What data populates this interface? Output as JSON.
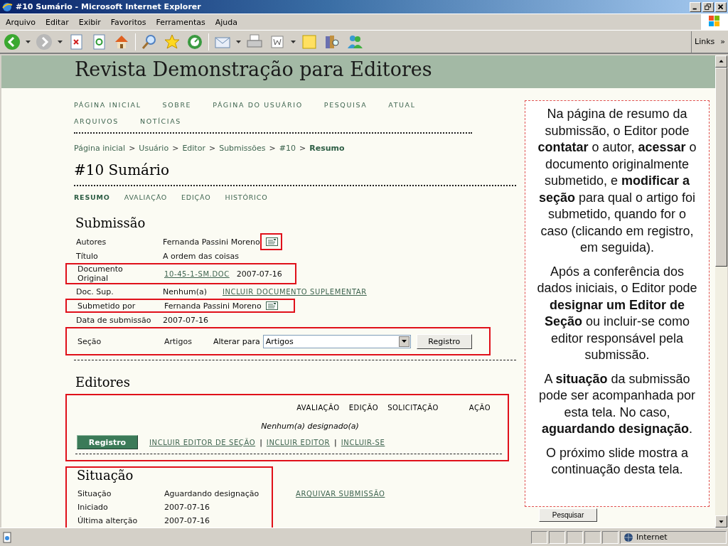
{
  "window": {
    "title": "#10 Sumário - Microsoft Internet Explorer"
  },
  "menu": [
    "Arquivo",
    "Editar",
    "Exibir",
    "Favoritos",
    "Ferramentas",
    "Ajuda"
  ],
  "toolbar": {
    "links": "Links",
    "more": "»"
  },
  "page": {
    "site_title": "Revista Demonstração para Editores",
    "nav": [
      "PÁGINA INICIAL",
      "SOBRE",
      "PÁGINA DO USUÁRIO",
      "PESQUISA",
      "ATUAL",
      "ARQUIVOS",
      "NOTÍCIAS"
    ],
    "breadcrumb": {
      "separator": ">",
      "items": [
        {
          "label": "Página inicial",
          "current": false
        },
        {
          "label": "Usuário",
          "current": false
        },
        {
          "label": "Editor",
          "current": false
        },
        {
          "label": "Submissões",
          "current": false
        },
        {
          "label": "#10",
          "current": false
        },
        {
          "label": "Resumo",
          "current": true
        }
      ]
    },
    "heading": "#10 Sumário",
    "tabs": [
      {
        "label": "RESUMO",
        "selected": true
      },
      {
        "label": "AVALIAÇÃO",
        "selected": false
      },
      {
        "label": "EDIÇÃO",
        "selected": false
      },
      {
        "label": "HISTÓRICO",
        "selected": false
      }
    ],
    "submission": {
      "title": "Submissão",
      "rows": [
        {
          "kind": "text",
          "label": "Autores",
          "value": "Fernanda Passini Moreno",
          "email": true,
          "icon_highlighted": true
        },
        {
          "kind": "text",
          "label": "Título",
          "value": "A ordem das coisas"
        },
        {
          "kind": "file",
          "label": "Documento Original",
          "link": "10-45-1-SM.DOC",
          "date": "2007-07-16",
          "highlighted": true
        },
        {
          "kind": "supp",
          "label": "Doc. Sup.",
          "value": "Nenhum(a)",
          "action": "INCLUIR DOCUMENTO SUPLEMENTAR"
        },
        {
          "kind": "text",
          "label": "Submetido por",
          "value": "Fernanda Passini Moreno",
          "email": true,
          "highlighted": true
        },
        {
          "kind": "text",
          "label": "Data de submissão",
          "value": "2007-07-16"
        },
        {
          "kind": "section",
          "label": "Seção",
          "value": "Artigos",
          "change_label": "Alterar para",
          "select_value": "Artigos",
          "button": "Registro",
          "highlighted": true
        }
      ]
    },
    "editors": {
      "title": "Editores",
      "highlighted": true,
      "columns": [
        "AVALIAÇÃO",
        "EDIÇÃO",
        "SOLICITAÇÃO",
        "AÇÃO"
      ],
      "empty": "Nenhum(a) designado(a)",
      "button": "Registro",
      "separator": "|",
      "links": [
        "INCLUIR EDITOR DE SEÇÃO",
        "INCLUIR EDITOR",
        "INCLUIR-SE"
      ]
    },
    "status": {
      "title": "Situação",
      "highlighted": true,
      "rows": [
        {
          "label": "Situação",
          "value": "Aguardando designação",
          "action": "ARQUIVAR SUBMISSÃO"
        },
        {
          "label": "Iniciado",
          "value": "2007-07-16"
        },
        {
          "label": "Última alterção",
          "value": "2007-07-16"
        }
      ]
    },
    "sidebar": {
      "button": "Pesquisar"
    }
  },
  "callout": {
    "paragraphs": [
      "Na página de resumo da submissão, o Editor pode **contatar** o autor, **acessar** o documento originalmente submetido, e **modificar a seção** para qual o artigo foi submetido, quando for o caso (clicando em registro, em seguida).",
      "Após a conferência dos dados iniciais, o Editor pode **designar um Editor de Seção** ou incluir-se como editor responsável pela submissão.",
      "A **situação** da submissão pode ser acompanhada por esta tela. No caso, **aguardando designação**.",
      "O próximo slide mostra a continuação desta tela."
    ]
  },
  "status_bar": {
    "zone": "Internet"
  }
}
